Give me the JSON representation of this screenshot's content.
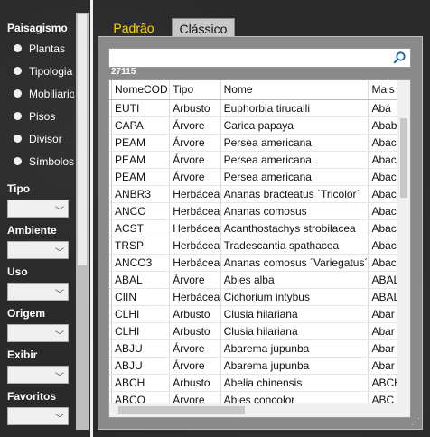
{
  "sidebar": {
    "paisagismo": {
      "title": "Paisagismo",
      "options": [
        "Plantas",
        "Tipologia",
        "Mobiliario",
        "Pisos",
        "Divisor",
        "Símbolos"
      ]
    },
    "filters": [
      {
        "label": "Tipo"
      },
      {
        "label": "Ambiente"
      },
      {
        "label": "Uso"
      },
      {
        "label": "Origem"
      },
      {
        "label": "Exibir"
      },
      {
        "label": "Favoritos"
      }
    ]
  },
  "tabs": [
    {
      "label": "Padrão",
      "active": true
    },
    {
      "label": "Clássico",
      "active": false
    }
  ],
  "search": {
    "value": "",
    "icon": "search-icon"
  },
  "count": "27115",
  "table": {
    "headers": [
      "NomeCOD",
      "Tipo",
      "Nome",
      "Mais"
    ],
    "rows": [
      [
        "EUTI",
        "Arbusto",
        "Euphorbia tirucalli",
        "Abá"
      ],
      [
        "CAPA",
        "Árvore",
        "Carica papaya",
        "Abab"
      ],
      [
        "PEAM",
        "Árvore",
        "Persea americana",
        "Abac"
      ],
      [
        "PEAM",
        "Árvore",
        "Persea americana",
        "Abac"
      ],
      [
        "PEAM",
        "Árvore",
        "Persea americana",
        "Abac"
      ],
      [
        "ANBR3",
        "Herbácea",
        "Ananas bracteatus ´Tricolor´",
        "Abac"
      ],
      [
        "ANCO",
        "Herbácea",
        "Ananas comosus",
        "Abac"
      ],
      [
        "ACST",
        "Herbácea",
        "Acanthostachys strobilacea",
        "Abac"
      ],
      [
        "TRSP",
        "Herbácea",
        "Tradescantia spathacea",
        "Abac"
      ],
      [
        "ANCO3",
        "Herbácea",
        "Ananas comosus ´Variegatus´",
        "Abac"
      ],
      [
        "ABAL",
        "Árvore",
        "Abies alba",
        "ABAL"
      ],
      [
        "CIIN",
        "Herbácea",
        "Cichorium intybus",
        "ABAL"
      ],
      [
        "CLHI",
        "Arbusto",
        "Clusia hilariana",
        "Abar"
      ],
      [
        "CLHI",
        "Arbusto",
        "Clusia hilariana",
        "Abar"
      ],
      [
        "ABJU",
        "Árvore",
        "Abarema jupunba",
        "Abar"
      ],
      [
        "ABJU",
        "Árvore",
        "Abarema jupunba",
        "Abar"
      ],
      [
        "ABCH",
        "Arbusto",
        "Abelia chinensis",
        "ABCH"
      ],
      [
        "ABCO",
        "Árvore",
        "Abies concolor",
        "ABC"
      ]
    ]
  },
  "colors": {
    "active_tab": "#ffd700",
    "panel_bg": "#8a8a8a",
    "sidebar_text": "#ffffff"
  }
}
